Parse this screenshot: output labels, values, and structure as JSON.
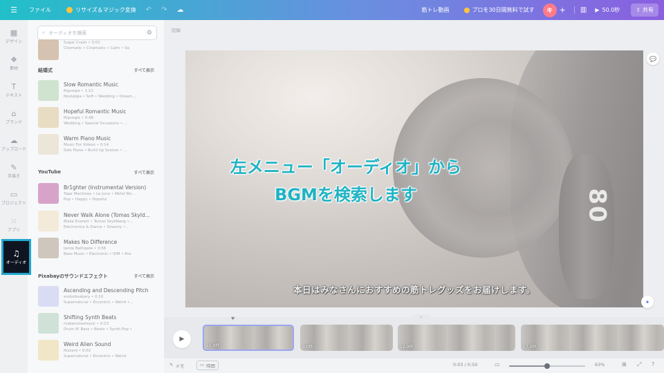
{
  "topbar": {
    "menu_icon": "☰",
    "file": "ファイル",
    "resize": "リサイズ＆マジック変換",
    "doc_title": "筋トレ動画",
    "trial": "プロを30日間無料で試す",
    "avatar": "キ",
    "plus": "+",
    "stats_icon": "bar-chart-icon",
    "play_time": "50.0秒",
    "share": "共有",
    "accent": "#21c0c8"
  },
  "rail": {
    "items": [
      {
        "label": "デザイン",
        "icon": "▦"
      },
      {
        "label": "素材",
        "icon": "❖"
      },
      {
        "label": "テキスト",
        "icon": "T"
      },
      {
        "label": "ブランド",
        "icon": "⌂"
      },
      {
        "label": "アップロード",
        "icon": "☁"
      },
      {
        "label": "手描き",
        "icon": "✎"
      },
      {
        "label": "プロジェクト",
        "icon": "▭"
      },
      {
        "label": "アプリ",
        "icon": "⁙"
      },
      {
        "label": "オーディオ",
        "icon": "♫"
      }
    ]
  },
  "panel": {
    "search_placeholder": "オーディオを検索",
    "top_partial": {
      "name": "Sugar Crash • 3:01",
      "meta": "Chematic • Cinematic • Calm • Sa"
    },
    "sections": [
      {
        "title": "結婚式",
        "see_all": "すべて表示",
        "tracks": [
          {
            "name": "Slow Romantic Music",
            "artist": "Rigvegie • 1:12",
            "meta": "Nostalgia • Soft • Wedding • Dream...",
            "color": "#cfe3cf"
          },
          {
            "name": "Hopeful Romantic Music",
            "artist": "Rigvegie • 0:48",
            "meta": "Wedding • Special Occasions • ...",
            "color": "#e8dcc2"
          },
          {
            "name": "Warm Piano Music",
            "artist": "Music For Videos • 0:14",
            "meta": "Solo Piano • Build Up Scenes • ...",
            "color": "#ece6d8"
          }
        ]
      },
      {
        "title": "YouTube",
        "see_all": "すべて表示",
        "tracks": [
          {
            "name": "Br1ghter (Instrumental Version)",
            "artist": "Tape Machines • Le June • Nbhd Nic...",
            "meta": "Pop • Happy • Hopeful",
            "color": "#d8a3c9"
          },
          {
            "name": "Never Walk Alone (Tomas Skyld...",
            "artist": "Blake Everett • Tomas Skyldberg •...",
            "meta": "Electronica & Dance • Dreamy •...",
            "color": "#f3ead9"
          },
          {
            "name": "Makes No Difference",
            "artist": "Jamie Bathgate • 3:56",
            "meta": "Bass Music • Electronic • IDM • Pos",
            "color": "#cfc6bd"
          }
        ]
      },
      {
        "title": "Pixabayのサウンドエフェクト",
        "see_all": "すべて表示",
        "tracks": [
          {
            "name": "Ascending and Descending Pitch",
            "artist": "endorbsabary • 0:10",
            "meta": "Supernatural • Eccentric • Weird •...",
            "color": "#d9dcf3"
          },
          {
            "name": "Shifting Synth Beats",
            "artist": "makenoisemusic • 0:23",
            "meta": "Drum N' Bass • Beats • Synth Pop •",
            "color": "#d0e2d8"
          },
          {
            "name": "Weird Alien Sound",
            "artist": "Rizzard • 0:02",
            "meta": "Supernatural • Eccentric • Weird",
            "color": "#f1e6c6"
          }
        ]
      }
    ]
  },
  "canvas": {
    "memo": "記録",
    "caption_line1": "左メニュー「オーディオ」から",
    "caption_line2": "BGMを検索します",
    "subtitle": "本日はみなさんにおすすめの筋トレグッズをお届けします。",
    "dial_number": "80",
    "caption_color": "#1eb3c4"
  },
  "timeline": {
    "clips": [
      {
        "duration": "10.0秒"
      },
      {
        "duration": "9.0秒"
      },
      {
        "duration": "12.9秒"
      },
      {
        "duration": "17.0秒"
      }
    ]
  },
  "bottombar": {
    "memo": "メモ",
    "time": "時間",
    "timecode": "0:03 / 0:50",
    "zoom_percent": "63%",
    "zoom_level": 0.5
  }
}
